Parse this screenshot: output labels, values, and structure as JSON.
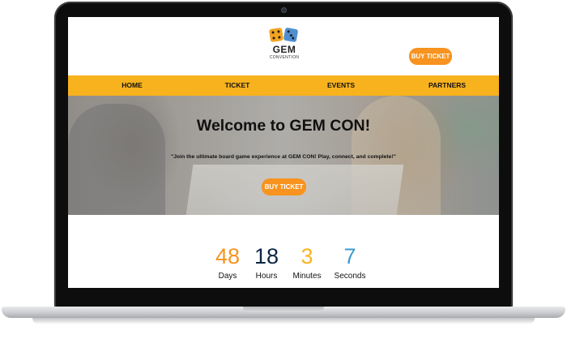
{
  "logo": {
    "title": "GEM",
    "subtitle": "CONVENTION"
  },
  "header": {
    "buy_label": "BUY TICKET"
  },
  "nav": {
    "items": [
      {
        "label": "HOME"
      },
      {
        "label": "TICKET"
      },
      {
        "label": "EVENTS"
      },
      {
        "label": "PARTNERS"
      }
    ]
  },
  "hero": {
    "title": "Welcome to GEM CON!",
    "tagline": "\"Join the ultimate board game experience at GEM CON! Play, connect, and complete!\"",
    "buy_label": "BUY TICKET"
  },
  "countdown": [
    {
      "value": "48",
      "label": "Days",
      "color": "#f7931e"
    },
    {
      "value": "18",
      "label": "Hours",
      "color": "#0b2545"
    },
    {
      "value": "3",
      "label": "Minutes",
      "color": "#f7b521"
    },
    {
      "value": "7",
      "label": "Seconds",
      "color": "#3d9ad1"
    }
  ],
  "colors": {
    "accent": "#f7931e",
    "nav_bg": "#f8b21d"
  },
  "icons": [
    "dice-logo-icon",
    "camera-icon"
  ]
}
